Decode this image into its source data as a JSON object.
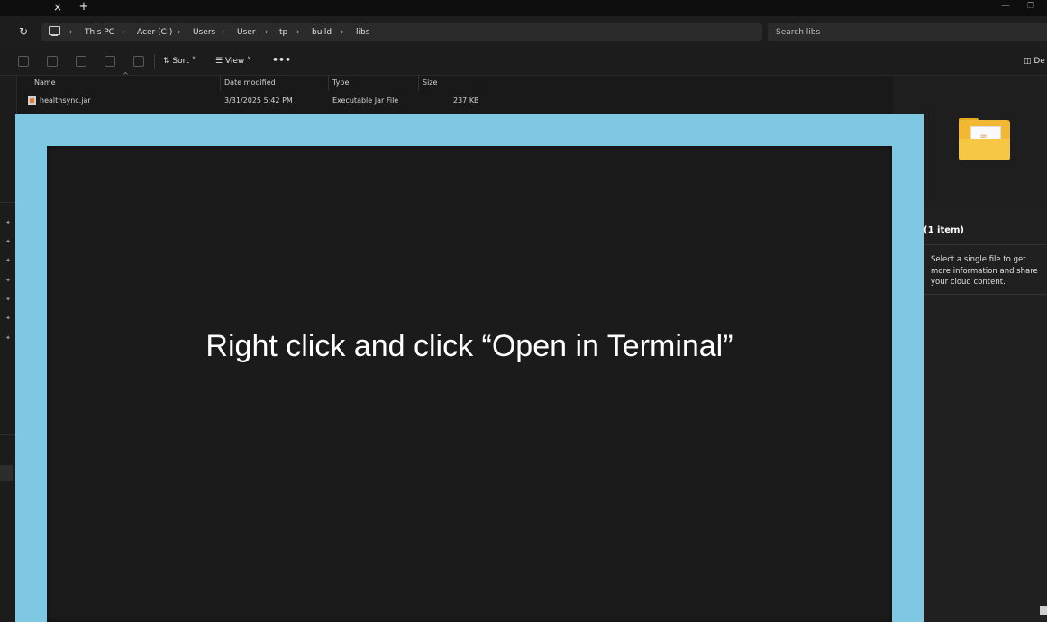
{
  "tabbar": {
    "close_glyph": "×",
    "new_glyph": "+",
    "minimize_glyph": "—",
    "maximize_glyph": "❐"
  },
  "breadcrumb": [
    "This PC",
    "Acer (C:)",
    "Users",
    "User",
    "tp",
    "build",
    "libs"
  ],
  "search": {
    "placeholder": "Search libs"
  },
  "toolbar": {
    "sort_label": "Sort",
    "view_label": "View",
    "more_label": "•••",
    "details_label": "De"
  },
  "columns": [
    "Name",
    "Date modified",
    "Type",
    "Size"
  ],
  "files": [
    {
      "name": "healthsync.jar",
      "date": "3/31/2025 5:42 PM",
      "type": "Executable Jar File",
      "size": "237 KB"
    }
  ],
  "details": {
    "count": "(1 item)",
    "message": "Select a single file to get more information and share your cloud content."
  },
  "overlay": {
    "text": "Right click and click “Open in Terminal”"
  },
  "colors": {
    "overlay_frame": "#7ec8e3",
    "folder": "#f2b733",
    "background": "#191919"
  }
}
